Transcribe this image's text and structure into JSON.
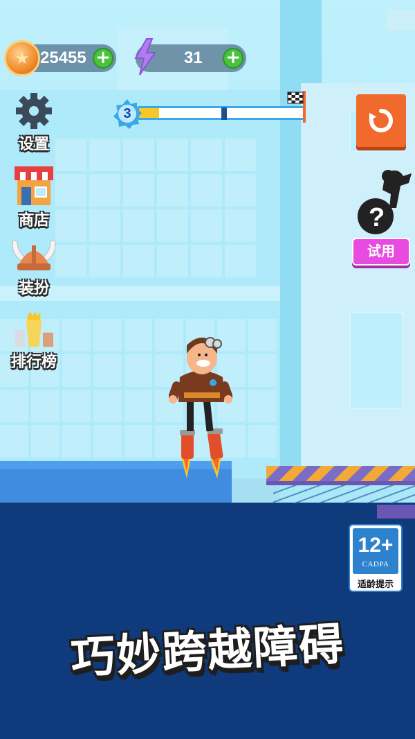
{
  "hud": {
    "coins": "25455",
    "energy": "31",
    "add_coins_label": "+",
    "add_energy_label": "+"
  },
  "level": {
    "number": "3",
    "progress": 0.12,
    "marker_position": 0.5
  },
  "menu": {
    "settings": "设置",
    "shop": "商店",
    "dressup": "装扮",
    "leaderboard": "排行榜"
  },
  "side": {
    "trial_label": "试用"
  },
  "age_rating": {
    "rating": "12+",
    "org": "CADPA",
    "tip": "适龄提示"
  },
  "banner": {
    "text": "巧妙跨越障碍"
  },
  "icons": {
    "coin": "coin-icon",
    "energy": "lightning-icon",
    "settings": "gear-icon",
    "shop": "shop-icon",
    "dressup": "viking-helmet-icon",
    "leaderboard": "trophy-icon",
    "restart": "restart-icon",
    "trial": "mystery-character-icon",
    "finish": "checkered-flag-icon"
  },
  "colors": {
    "sea": "#0f3b7c",
    "ground": "#3f8ce0",
    "restart_button": "#f06a2d",
    "trial_button": "#e84be0",
    "progress_fill": "#f7c628"
  }
}
